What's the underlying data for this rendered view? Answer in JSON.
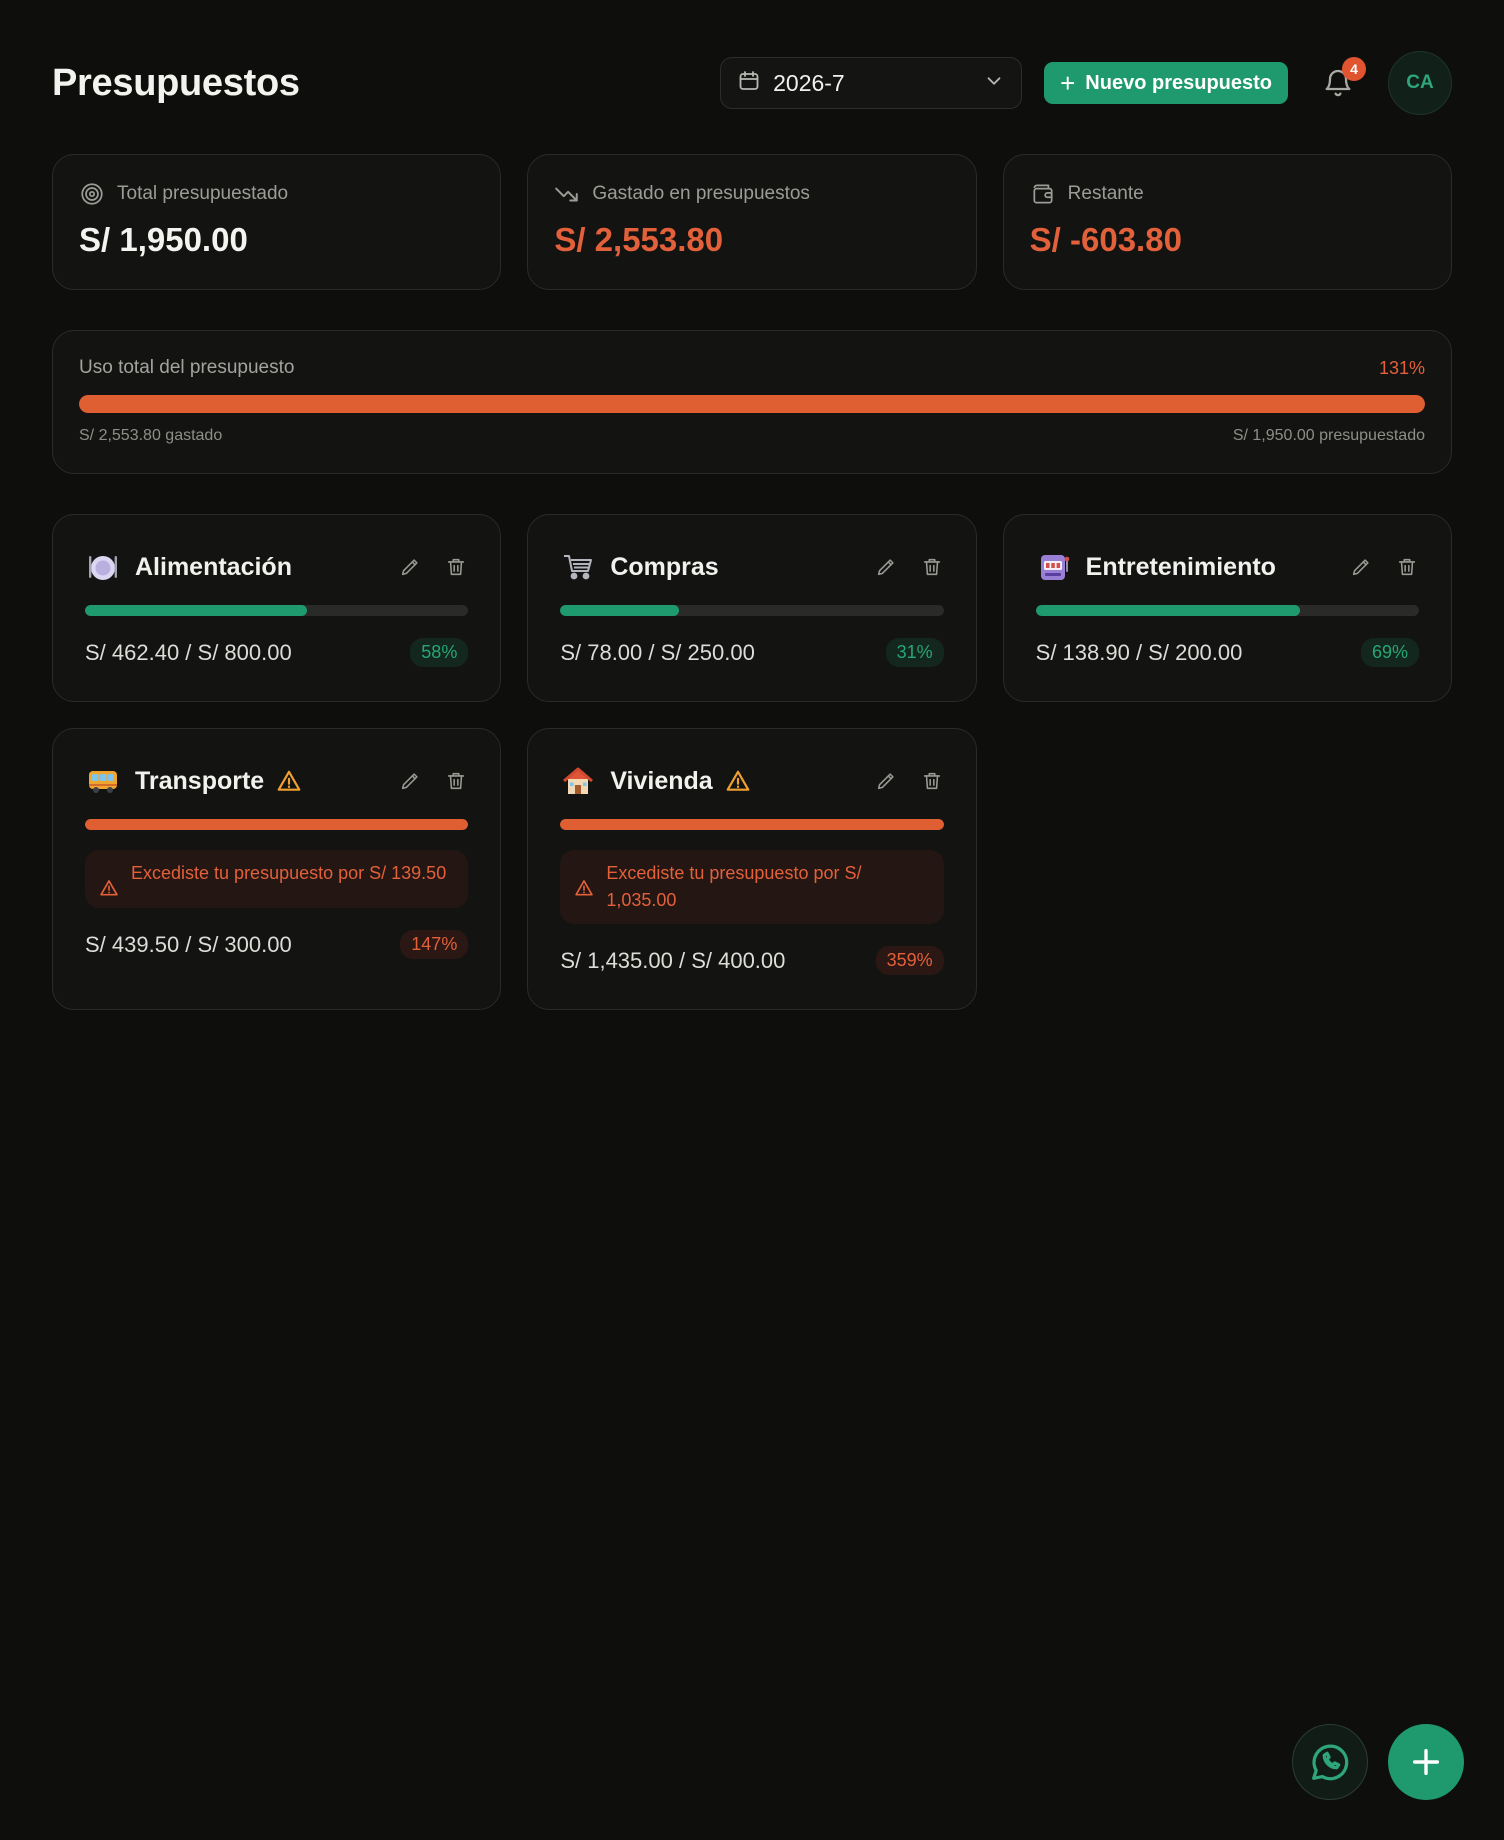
{
  "header": {
    "title": "Presupuestos",
    "month": "2026-7",
    "new_button": "Nuevo presupuesto",
    "notifications_count": "4",
    "avatar_initials": "CA"
  },
  "summary": {
    "total_label": "Total presupuestado",
    "total_value": "S/ 1,950.00",
    "spent_label": "Gastado en presupuestos",
    "spent_value": "S/ 2,553.80",
    "remaining_label": "Restante",
    "remaining_value": "S/ -603.80"
  },
  "usage": {
    "label": "Uso total del presupuesto",
    "percent_text": "131%",
    "fill_percent": 100,
    "spent_text": "S/ 2,553.80 gastado",
    "budget_text": "S/ 1,950.00 presupuestado"
  },
  "categories": [
    {
      "name": "Alimentación",
      "icon": "plate-icon",
      "progress": 58,
      "amount": "S/ 462.40 / S/ 800.00",
      "percent": "58%",
      "over": false
    },
    {
      "name": "Compras",
      "icon": "cart-icon",
      "progress": 31,
      "amount": "S/ 78.00 / S/ 250.00",
      "percent": "31%",
      "over": false
    },
    {
      "name": "Entretenimiento",
      "icon": "slot-machine-icon",
      "progress": 69,
      "amount": "S/ 138.90 / S/ 200.00",
      "percent": "69%",
      "over": false
    },
    {
      "name": "Transporte",
      "icon": "bus-icon",
      "progress": 100,
      "amount": "S/ 439.50 / S/ 300.00",
      "percent": "147%",
      "over": true,
      "alert": "Excediste tu presupuesto por S/ 139.50"
    },
    {
      "name": "Vivienda",
      "icon": "house-icon",
      "progress": 100,
      "amount": "S/ 1,435.00 / S/ 400.00",
      "percent": "359%",
      "over": true,
      "alert": "Excediste tu presupuesto por S/ 1,035.00"
    }
  ],
  "colors": {
    "accent_green": "#1f9a6e",
    "danger_orange": "#df5f33",
    "warning_amber": "#f0a030",
    "background": "#0e0e0d"
  }
}
